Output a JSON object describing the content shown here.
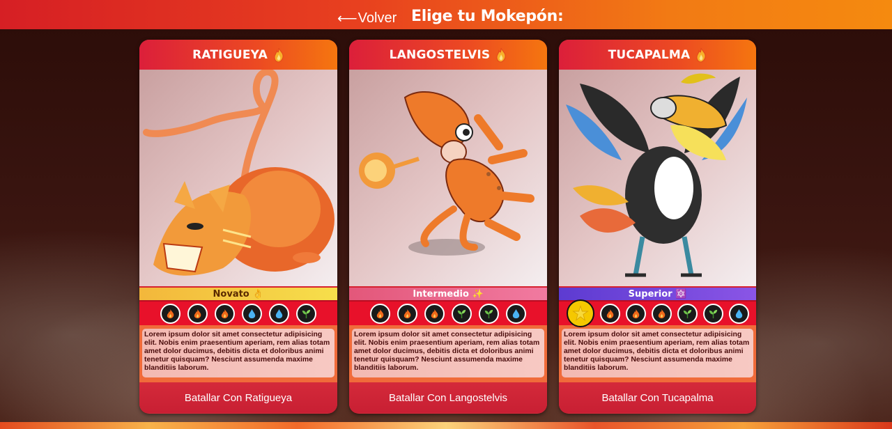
{
  "header": {
    "back_label": "Volver",
    "title": "Elige tu Mokepón:"
  },
  "colors": {
    "header_gradient_start": "#d61f24",
    "header_gradient_end": "#f58a0f",
    "card_red": "#d42a3a",
    "attack_bar": "#e8112a",
    "tier_novato": "#f3b73b",
    "tier_intermedio": "#e3577a",
    "tier_superior": "#5d3bd1"
  },
  "cards": [
    {
      "name": "RATIGUEYA",
      "type_icon": "flame-icon",
      "tier_label": "Novato 👌",
      "attacks": [
        "fire-icon",
        "fire-icon",
        "fire-icon",
        "water-icon",
        "water-icon",
        "plant-icon"
      ],
      "description": "Lorem ipsum dolor sit amet consectetur adipisicing elit. Nobis enim praesentium aperiam, rem alias totam amet dolor ducimus, debitis dicta et doloribus animi tenetur quisquam? Nesciunt assumenda maxime blanditiis laborum.",
      "button_label": "Batallar Con Ratigueya"
    },
    {
      "name": "LANGOSTELVIS",
      "type_icon": "flame-icon",
      "tier_label": "Intermedio ✨",
      "attacks": [
        "fire-icon",
        "fire-icon",
        "fire-icon",
        "plant-icon",
        "plant-icon",
        "water-icon"
      ],
      "description": "Lorem ipsum dolor sit amet consectetur adipisicing elit. Nobis enim praesentium aperiam, rem alias totam amet dolor ducimus, debitis dicta et doloribus animi tenetur quisquam? Nesciunt assumenda maxime blanditiis laborum.",
      "button_label": "Batallar Con Langostelvis"
    },
    {
      "name": "TUCAPALMA",
      "type_icon": "flame-icon",
      "tier_label": "Superior 🔯",
      "attacks": [
        "special-icon",
        "fire-icon",
        "fire-icon",
        "fire-icon",
        "plant-icon",
        "plant-icon",
        "water-icon"
      ],
      "description": "Lorem ipsum dolor sit amet consectetur adipisicing elit. Nobis enim praesentium aperiam, rem alias totam amet dolor ducimus, debitis dicta et doloribus animi tenetur quisquam? Nesciunt assumenda maxime blanditiis laborum.",
      "button_label": "Batallar Con Tucapalma"
    }
  ]
}
